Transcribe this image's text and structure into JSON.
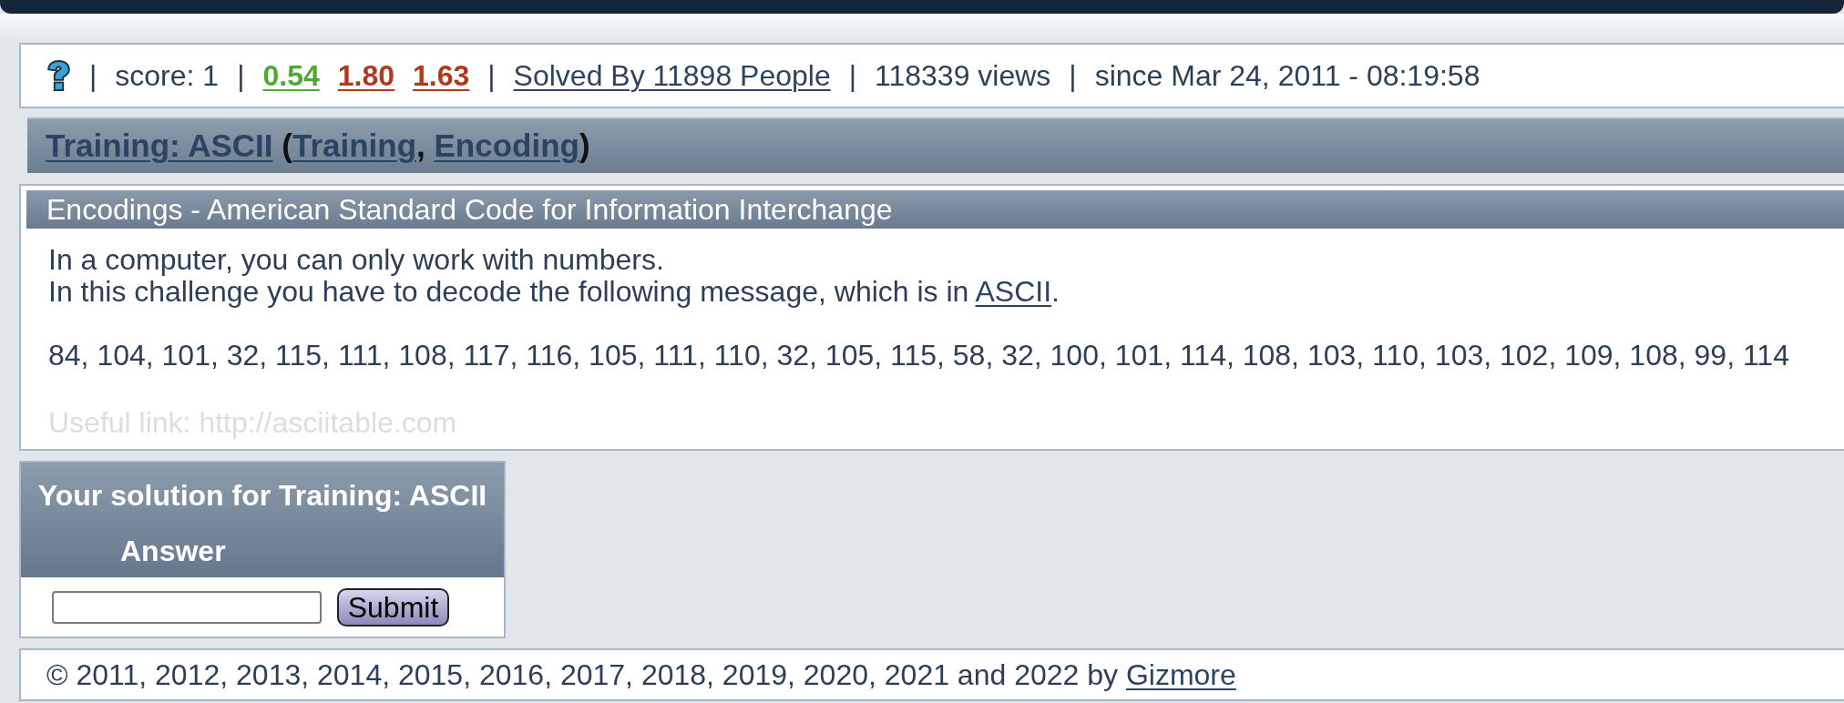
{
  "stats_bar": [
    {
      "kind": "separator",
      "text": "|"
    },
    {
      "kind": "text",
      "text": "score: 1"
    },
    {
      "kind": "separator",
      "text": "|"
    },
    {
      "kind": "rating",
      "text": "0.54",
      "color": "#4fa82f"
    },
    {
      "kind": "rating",
      "text": "1.80",
      "color": "#b3381b"
    },
    {
      "kind": "rating",
      "text": "1.63",
      "color": "#b3381b"
    },
    {
      "kind": "separator",
      "text": "|"
    },
    {
      "kind": "link",
      "text": "Solved By 11898 People"
    },
    {
      "kind": "separator",
      "text": "|"
    },
    {
      "kind": "text",
      "text": "118339 views"
    },
    {
      "kind": "separator",
      "text": "|"
    },
    {
      "kind": "text",
      "text": "since Mar 24, 2011 - 08:19:58"
    }
  ],
  "title": [
    {
      "kind": "link",
      "text": "Training: ASCII"
    },
    {
      "kind": "plain",
      "text": " ("
    },
    {
      "kind": "link",
      "text": "Training"
    },
    {
      "kind": "plain",
      "text": ", "
    },
    {
      "kind": "link",
      "text": "Encoding"
    },
    {
      "kind": "plain",
      "text": ")"
    }
  ],
  "challenge": {
    "header": "Encodings - American Standard Code for Information Interchange",
    "lines": [
      [
        {
          "kind": "plain",
          "text": "In a computer, you can only work with numbers."
        }
      ],
      [
        {
          "kind": "plain",
          "text": "In this challenge you have to decode the following message, which is in "
        },
        {
          "kind": "link",
          "text": "ASCII"
        },
        {
          "kind": "plain",
          "text": "."
        }
      ]
    ],
    "message": "84, 104, 101, 32, 115, 111, 108, 117, 116, 105, 111, 110, 32, 105, 115, 58, 32, 100, 101, 114, 108, 103, 110, 103, 102, 109, 108, 99, 114",
    "hint": "Useful link: http://asciitable.com"
  },
  "solution_form": {
    "title": "Your solution for Training: ASCII",
    "label": "Answer",
    "submit": "Submit"
  },
  "footer": [
    {
      "kind": "plain",
      "text": "© 2011, 2012, 2013, 2014, 2015, 2016, 2017, 2018, 2019, 2020, 2021 and 2022 by "
    },
    {
      "kind": "link",
      "text": "Gizmore"
    }
  ]
}
